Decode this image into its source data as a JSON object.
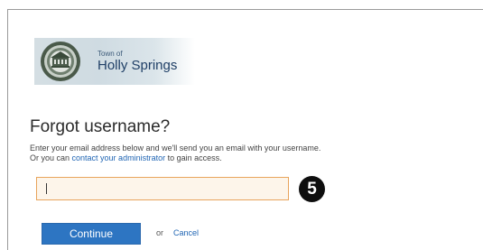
{
  "logo": {
    "small_text": "Town of",
    "big_text": "Holly Springs"
  },
  "page": {
    "title": "Forgot username?",
    "desc_line1": "Enter your email address below and we'll send you an email with your username.",
    "desc_line2_prefix": "Or you can ",
    "desc_link": "contact your administrator",
    "desc_line2_suffix": " to gain access."
  },
  "form": {
    "email_value": "",
    "email_placeholder": ""
  },
  "annotation": {
    "step_badge": "5"
  },
  "actions": {
    "continue_label": "Continue",
    "or_text": "or",
    "cancel_label": "Cancel"
  },
  "colors": {
    "button_blue": "#2d75c2",
    "link_blue": "#2166b4",
    "input_border": "#e8a45c",
    "input_bg": "#fdf5ea"
  },
  "icons": {
    "seal": "town-seal-icon"
  }
}
